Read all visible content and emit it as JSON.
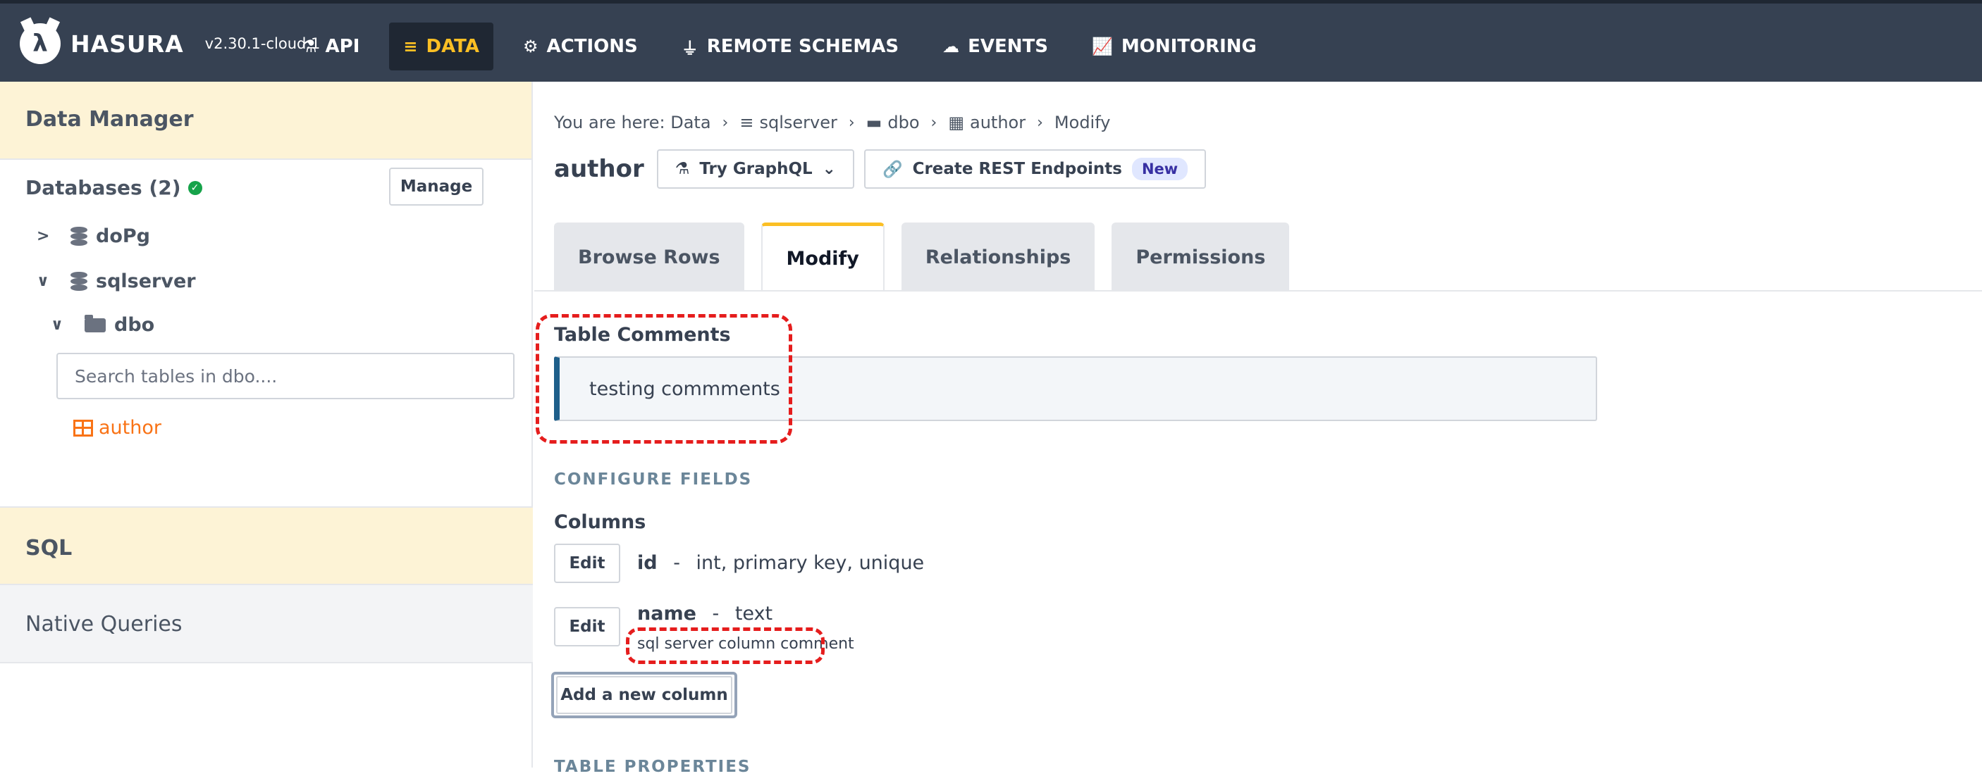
{
  "header": {
    "logo_text": "HASURA",
    "version": "v2.30.1-cloud.1",
    "nav": [
      {
        "label": "API",
        "icon": "flask-icon"
      },
      {
        "label": "DATA",
        "icon": "database-icon",
        "active": true
      },
      {
        "label": "ACTIONS",
        "icon": "cogs-icon"
      },
      {
        "label": "REMOTE SCHEMAS",
        "icon": "plug-icon"
      },
      {
        "label": "EVENTS",
        "icon": "cloud-icon"
      },
      {
        "label": "MONITORING",
        "icon": "chart-line-icon"
      }
    ]
  },
  "sidebar": {
    "title": "Data Manager",
    "databases_label": "Databases (2)",
    "manage_label": "Manage",
    "tree": {
      "db1": "doPg",
      "db2": "sqlserver",
      "schema": "dbo",
      "table": "author"
    },
    "search_placeholder": "Search tables in dbo....",
    "sql_label": "SQL",
    "native_queries_label": "Native Queries"
  },
  "main": {
    "breadcrumb": {
      "prefix": "You are here: Data",
      "db": "sqlserver",
      "schema": "dbo",
      "table": "author",
      "current": "Modify"
    },
    "title": "author",
    "try_graphql_label": "Try GraphQL",
    "rest_label": "Create REST Endpoints",
    "new_badge": "New",
    "tabs": [
      "Browse Rows",
      "Modify",
      "Relationships",
      "Permissions"
    ],
    "table_comments_label": "Table Comments",
    "table_comment": "testing commments",
    "configure_fields_label": "CONFIGURE FIELDS",
    "columns_label": "Columns",
    "edit_label": "Edit",
    "columns": [
      {
        "name": "id",
        "sep": "-",
        "type": "int, primary key, unique"
      },
      {
        "name": "name",
        "sep": "-",
        "type": "text",
        "comment": "sql server column comment"
      }
    ],
    "add_column_label": "Add a new column",
    "table_properties_label": "TABLE PROPERTIES"
  },
  "colors": {
    "topbar": "#364152",
    "active_nav_text": "#fbbf24",
    "section_bg": "#fdf3d6",
    "table_accent": "#f97316",
    "highlight": "#e51d1d"
  }
}
